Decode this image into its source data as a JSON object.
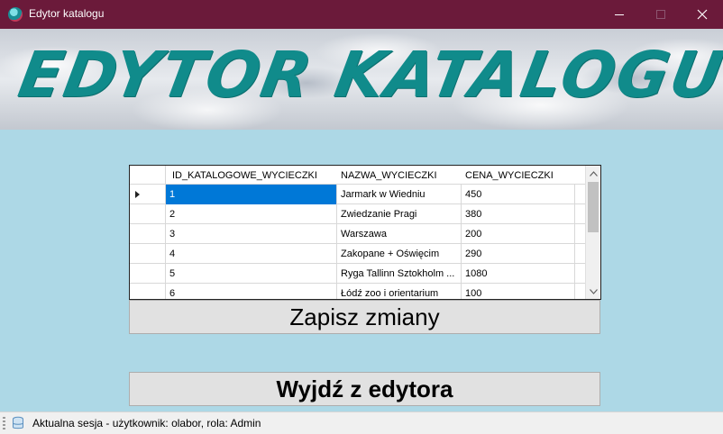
{
  "window": {
    "title": "Edytor katalogu"
  },
  "banner": {
    "text": "EDYTOR KATALOGU"
  },
  "grid": {
    "columns": [
      "ID_KATALOGOWE_WYCIECZKI",
      "NAZWA_WYCIECZKI",
      "CENA_WYCIECZKI"
    ],
    "rows": [
      [
        "1",
        "Jarmark w Wiedniu",
        "450"
      ],
      [
        "2",
        "Zwiedzanie Pragi",
        "380"
      ],
      [
        "3",
        "Warszawa",
        "200"
      ],
      [
        "4",
        "Zakopane + Oświęcim",
        "290"
      ],
      [
        "5",
        "Ryga Tallinn Sztokholm ...",
        "1080"
      ],
      [
        "6",
        "Łódź zoo i orientarium",
        "100"
      ]
    ],
    "selected_row": 1
  },
  "buttons": {
    "save_label": "Zapisz zmiany",
    "exit_label": "Wyjdź z edytora"
  },
  "status": {
    "text": "Aktualna sesja - użytkownik: olabor, rola: Admin"
  },
  "colors": {
    "titlebar": "#6b1a3a",
    "background": "#add8e6",
    "banner_text": "#108b8b",
    "selection": "#0078d7"
  }
}
